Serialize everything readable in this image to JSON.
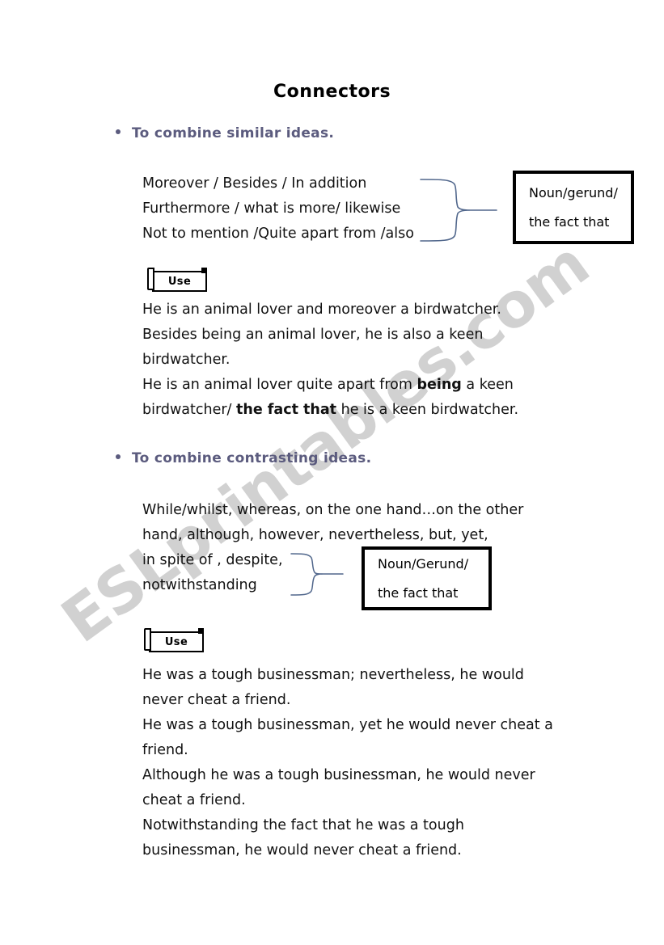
{
  "document": {
    "title": "Connectors"
  },
  "watermark": {
    "text": "ESLprintables.com",
    "color": "#c9c9c9"
  },
  "sections": [
    {
      "bullet": "To combine similar ideas.",
      "bullet_color": "#5b5b7e",
      "connectors": [
        "Moreover / Besides / In addition",
        "Furthermore / what is more/ likewise",
        "Not to mention /Quite apart from /also"
      ],
      "box": {
        "line1": "Noun/gerund/",
        "line2": "the fact that"
      },
      "use_label": "Use",
      "examples": [
        "He is an animal lover and moreover a birdwatcher.",
        "Besides being an animal lover, he is also a keen",
        "birdwatcher.",
        "He is an animal lover quite apart from being a keen",
        "birdwatcher/ the fact that he is a keen birdwatcher."
      ],
      "example_bold_terms": [
        "being",
        "the fact that"
      ]
    },
    {
      "bullet": "To combine contrasting ideas.",
      "bullet_color": "#5b5b7e",
      "connectors": [
        "While/whilst, whereas, on the one hand…on the other",
        "hand, although, however, nevertheless, but, yet,",
        " in spite of , despite,",
        "notwithstanding"
      ],
      "box": {
        "line1": "Noun/Gerund/",
        "line2": "the fact that"
      },
      "use_label": "Use",
      "examples": [
        "He was a tough businessman; nevertheless, he would",
        "never cheat a friend.",
        "He was a tough businessman, yet he would never cheat a",
        "friend.",
        "Although he was a tough businessman, he would never",
        "cheat a friend.",
        "Notwithstanding the fact that he was a tough",
        "businessman, he would never cheat a friend."
      ]
    }
  ]
}
